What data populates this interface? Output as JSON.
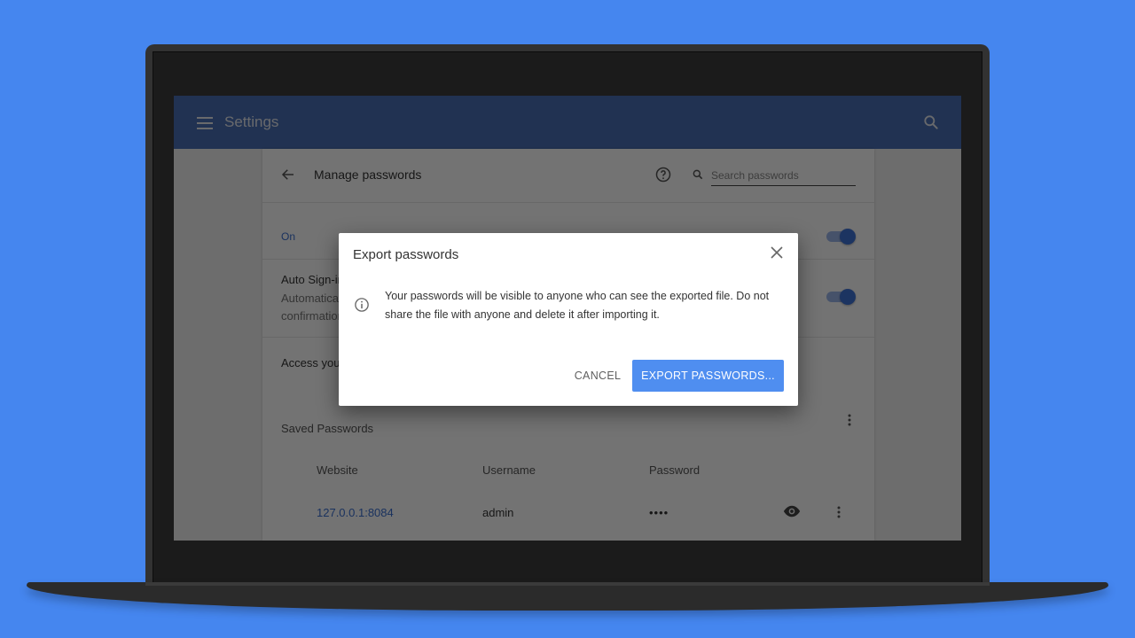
{
  "app_bar": {
    "title": "Settings",
    "menu_icon": "hamburger-menu-icon",
    "search_icon": "search-icon"
  },
  "page": {
    "title": "Manage passwords",
    "back_icon": "back-arrow-icon",
    "help_icon": "help-circle-icon",
    "search": {
      "placeholder": "Search passwords",
      "value": ""
    }
  },
  "settings": {
    "save_passwords": {
      "label": "On",
      "enabled": true
    },
    "auto_signin": {
      "title": "Auto Sign-in",
      "description": "Automatically sign in to websites using stored credentials. If disabled, you'll be asked for confirmation every time before signing in to a website.",
      "enabled": true
    },
    "access_text": "Access your passwords from any device"
  },
  "saved_passwords": {
    "title": "Saved Passwords",
    "more_icon": "more-vert-icon",
    "columns": [
      "Website",
      "Username",
      "Password"
    ],
    "rows": [
      {
        "website": "127.0.0.1:8084",
        "username": "admin",
        "password": "••••"
      }
    ]
  },
  "dialog": {
    "title": "Export passwords",
    "close_icon": "close-icon",
    "info_icon": "info-icon",
    "body": "Your passwords will be visible to anyone who can see the exported file. Do not share the file with anyone and delete it after importing it.",
    "cancel_label": "CANCEL",
    "export_label": "EXPORT PASSWORDS..."
  },
  "colors": {
    "background": "#4586ef",
    "app_bar": "#4a70b5",
    "accent": "#4f8ef0",
    "link": "#3b6fd1"
  }
}
